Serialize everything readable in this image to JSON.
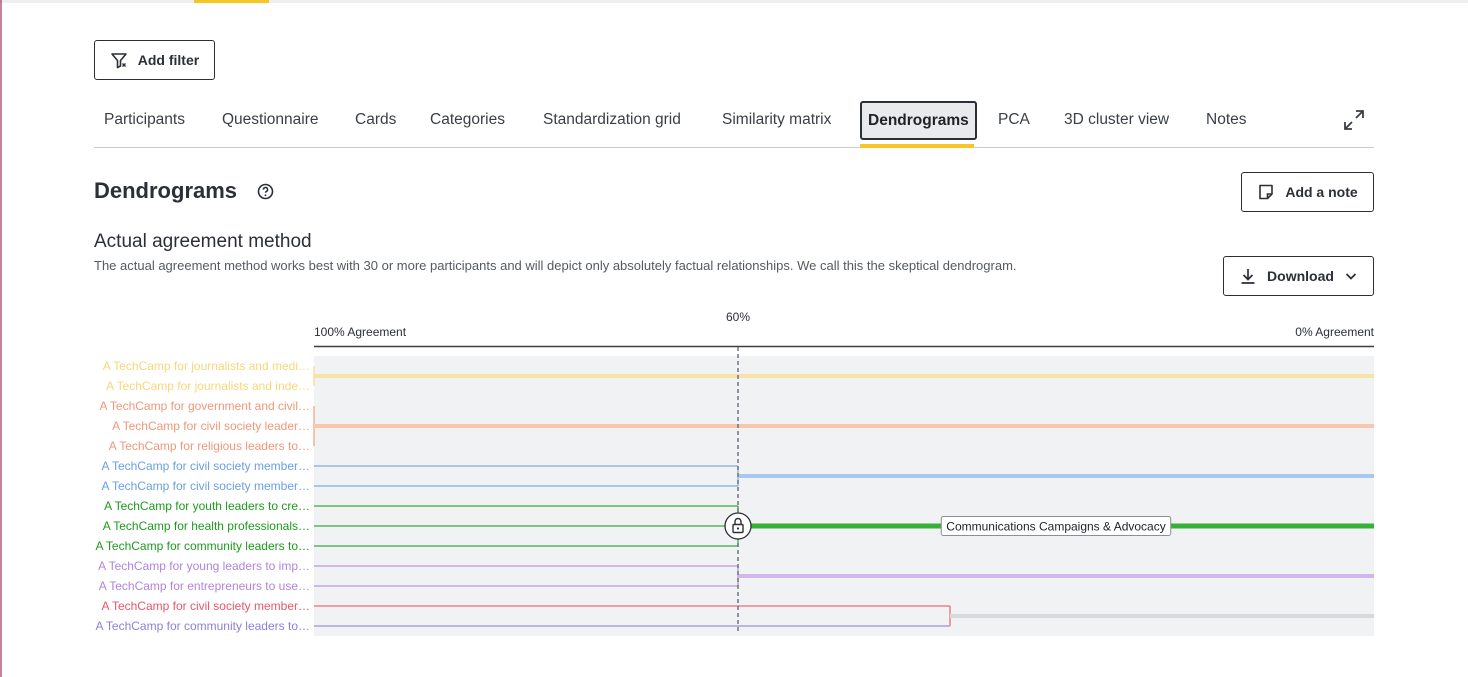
{
  "toolbar": {
    "add_filter_label": "Add filter"
  },
  "tabs": [
    {
      "label": "Participants",
      "active": false
    },
    {
      "label": "Questionnaire",
      "active": false
    },
    {
      "label": "Cards",
      "active": false
    },
    {
      "label": "Categories",
      "active": false
    },
    {
      "label": "Standardization grid",
      "active": false
    },
    {
      "label": "Similarity matrix",
      "active": false
    },
    {
      "label": "Dendrograms",
      "active": true
    },
    {
      "label": "PCA",
      "active": false
    },
    {
      "label": "3D cluster view",
      "active": false
    },
    {
      "label": "Notes",
      "active": false
    }
  ],
  "page": {
    "title": "Dendrograms",
    "add_note_label": "Add a note",
    "help_icon": "question-circle-icon",
    "expand_icon": "expand-arrows-icon"
  },
  "section": {
    "title": "Actual agreement method",
    "description": "The actual agreement method works best with 30 or more participants and will depict only absolutely factual relationships. We call this the skeptical dendrogram.",
    "download_label": "Download"
  },
  "dendrogram": {
    "left_axis_label": "100% Agreement",
    "right_axis_label": "0% Agreement",
    "threshold_label": "60%",
    "threshold_percent": 60,
    "selected_cluster_label": "Communications Campaigns & Advocacy",
    "lock_icon": "lock-icon",
    "leaves": [
      {
        "label": "A TechCamp for journalists and medi…",
        "color": "#f7d77a"
      },
      {
        "label": "A TechCamp for journalists and inde…",
        "color": "#f7d77a"
      },
      {
        "label": "A TechCamp for government and civil…",
        "color": "#f0977a"
      },
      {
        "label": "A TechCamp for civil society leader…",
        "color": "#f0977a"
      },
      {
        "label": "A TechCamp for religious leaders to…",
        "color": "#f0977a"
      },
      {
        "label": "A TechCamp for civil society member…",
        "color": "#6aa0e0"
      },
      {
        "label": "A TechCamp for civil society member…",
        "color": "#6aa0e0"
      },
      {
        "label": "A TechCamp for youth leaders to cre…",
        "color": "#1e9a1e"
      },
      {
        "label": "A TechCamp for health professionals…",
        "color": "#1e9a1e"
      },
      {
        "label": "A TechCamp for community leaders to…",
        "color": "#1e9a1e"
      },
      {
        "label": "A TechCamp for young leaders to imp…",
        "color": "#b184dc"
      },
      {
        "label": "A TechCamp for entrepreneurs to use…",
        "color": "#b184dc"
      },
      {
        "label": "A TechCamp for civil society member…",
        "color": "#e8566a"
      },
      {
        "label": "A TechCamp for community leaders to…",
        "color": "#8f7fd6"
      }
    ],
    "clusters": [
      {
        "leaves": [
          0,
          1
        ],
        "merge_agreement": 100,
        "color": "#f9e2a8"
      },
      {
        "leaves": [
          2,
          3,
          4
        ],
        "merge_agreement": 100,
        "color": "#f8c7ad"
      },
      {
        "leaves": [
          5,
          6
        ],
        "merge_agreement": 60,
        "color": "#a9c8ee"
      },
      {
        "leaves": [
          7,
          8,
          9
        ],
        "merge_agreement": 60,
        "color": "#37b037",
        "selected": true
      },
      {
        "leaves": [
          10,
          11
        ],
        "merge_agreement": 60,
        "color": "#d1b6ee"
      },
      {
        "leaves": [
          12,
          13
        ],
        "merge_agreement": 40,
        "color": "#d8d9dc"
      }
    ]
  }
}
